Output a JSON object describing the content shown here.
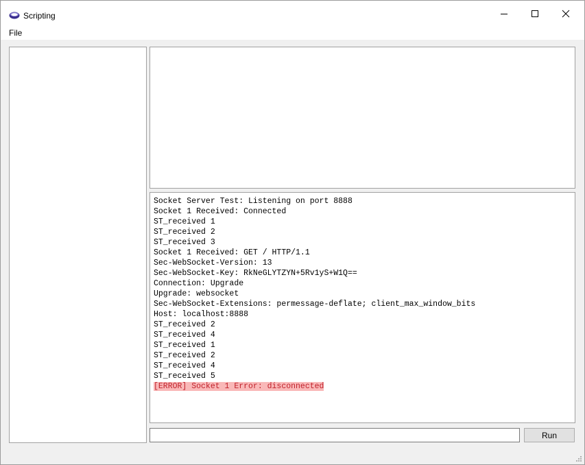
{
  "window": {
    "title": "Scripting",
    "icon": "app-icon"
  },
  "menu": {
    "items": [
      {
        "label": "File"
      }
    ]
  },
  "console": {
    "lines": [
      {
        "text": "Socket Server Test: Listening on port 8888",
        "type": "normal"
      },
      {
        "text": "Socket 1 Received: Connected",
        "type": "normal"
      },
      {
        "text": "ST_received 1",
        "type": "normal"
      },
      {
        "text": "ST_received 2",
        "type": "normal"
      },
      {
        "text": "ST_received 3",
        "type": "normal"
      },
      {
        "text": "Socket 1 Received: GET / HTTP/1.1",
        "type": "normal"
      },
      {
        "text": "Sec-WebSocket-Version: 13",
        "type": "normal"
      },
      {
        "text": "Sec-WebSocket-Key: RkNeGLYTZYN+5Rv1yS+W1Q==",
        "type": "normal"
      },
      {
        "text": "Connection: Upgrade",
        "type": "normal"
      },
      {
        "text": "Upgrade: websocket",
        "type": "normal"
      },
      {
        "text": "Sec-WebSocket-Extensions: permessage-deflate; client_max_window_bits",
        "type": "normal"
      },
      {
        "text": "Host: localhost:8888",
        "type": "normal"
      },
      {
        "text": "ST_received 2",
        "type": "normal"
      },
      {
        "text": "ST_received 4",
        "type": "normal"
      },
      {
        "text": "ST_received 1",
        "type": "normal"
      },
      {
        "text": "ST_received 2",
        "type": "normal"
      },
      {
        "text": "ST_received 4",
        "type": "normal"
      },
      {
        "text": "ST_received 5",
        "type": "normal"
      },
      {
        "text": "[ERROR] Socket 1 Error: disconnected",
        "type": "error"
      }
    ],
    "error_background": "#f9b8b8",
    "error_text_color": "#c0202a"
  },
  "command": {
    "value": "",
    "run_label": "Run"
  }
}
